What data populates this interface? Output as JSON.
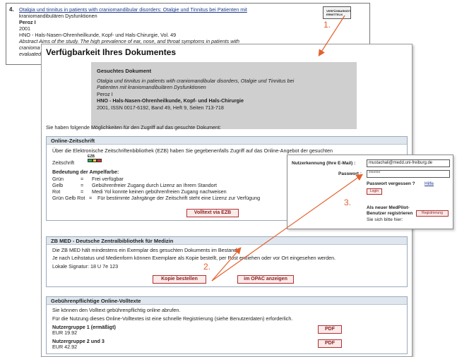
{
  "result": {
    "number": "4.",
    "title": "Otalgia und tinnitus in patients with craniomandibular disorders: Otalgie und Tinnitus bei Patienten mit",
    "title_cont": "kraniomandibulären Dysfunktionen",
    "author": "Peroz I",
    "year": "2001",
    "journal": "HNO - Hals-Nasen-Ohrenheilkunde, Kopf- und Hals-Chirurgie, Vol. 49",
    "abstract_1": "Abstract Aims of the study. The high prevalence of ear, nose, and throat symptoms in patients with",
    "abstract_2": "cranioma",
    "abstract_3": "evaluated",
    "vfz_label_1": "VERFÜGBARKEIT",
    "vfz_label_2": "ERMITTELN"
  },
  "panel": {
    "title": "Verfügbarkeit Ihres Dokumentes",
    "doc_heading": "Gesuchtes Dokument",
    "doc_title_1": "Otalgia und tinnitus in patients with craniomandibular disorders, Otalgie und Tinnitus bei",
    "doc_title_2": "Patienten mit kraniomandibulären Dysfunktionen",
    "doc_author": "Peroz I",
    "doc_journal": "HNO - Hals-Nasen-Ohrenheilkunde, Kopf- und Hals-Chirurgie",
    "doc_details": "2001, ISSN 0017-6192, Band 49, Heft 9, Seiten 713-718",
    "intro": "Sie haben folgende Möglichkeiten für den Zugriff auf das gesuchte Dokument:"
  },
  "online": {
    "heading": "Online-Zeitschrift",
    "text": "Über die Elektronische Zeitschriftenbibliothek (EZB) haben Sie gegebenenfalls Zugriff auf das Online-Angebot der gesuchten",
    "zeitschrift": "Zeitschrift",
    "ezb_label": "EZB",
    "legend_heading": "Bedeutung der Ampelfarbe:",
    "legend": [
      {
        "color": "Grün",
        "sep": "=",
        "text": "Frei verfügbar"
      },
      {
        "color": "Gelb",
        "sep": "=",
        "text": "Gebührenfreier Zugang durch Lizenz an Ihrem Standort"
      },
      {
        "color": "Rot",
        "sep": "=",
        "text": "Medi Yol konnte keinen gebührenfreien Zugang nachweisen"
      },
      {
        "color": "Grün Gelb Rot",
        "sep": "=",
        "text": "Für bestimmte Jahrgänge der Zeitschrift steht eine Lizenz zur Verfügung"
      }
    ],
    "button": "Volltext via EZB"
  },
  "zbmed": {
    "heading": "ZB MED - Deutsche Zentralbibliothek für Medizin",
    "line1": "Die ZB MED hält mindestens ein Exemplar des gesuchten Dokuments im Bestand",
    "line2": "Je nach Leihstatus und Medienform können Exemplare als Kopie bestellt, per Post entliehen oder vor Ort eingesehen werden.",
    "line3": "Lokale Signatur: 18 U 7e 123",
    "btn_copy": "Kopie bestellen",
    "btn_opac": "im OPAC anzeigen"
  },
  "paid": {
    "heading": "Gebührenpflichtige Online-Volltexte",
    "line1": "Sie können den Volltext gebührenpflichtig online abrufen.",
    "line2": "Für die Nutzung dieses Online-Volltextes ist eine schnelle Registrierung (siehe Benutzerdaten) erforderlich.",
    "groups": [
      {
        "name": "Nutzergruppe 1 (ermäßigt)",
        "price": "EUR 19.92",
        "btn": "PDF"
      },
      {
        "name": "Nutzergruppe 2 und 3",
        "price": "EUR 42.92",
        "btn": "PDF"
      }
    ]
  },
  "login": {
    "user_label": "Nutzerkennung (Ihre E-Mail) :",
    "user_value": "mustachali@medd.uni-freiburg.de",
    "pw_label": "Passwort :",
    "pw_value": "*******",
    "forgot": "Passwort vergessen ?",
    "help": "Hilfe",
    "login_btn": "Login",
    "new_user_1": "Als neuer MedPilot-",
    "new_user_2": "Benutzer registrieren",
    "register_btn": "Registrierung",
    "new_user_3": "Sie sich bitte hier:"
  },
  "annotations": {
    "step1": "1.",
    "step2": "2.",
    "step3": "3.",
    "color": "#e4602c"
  }
}
